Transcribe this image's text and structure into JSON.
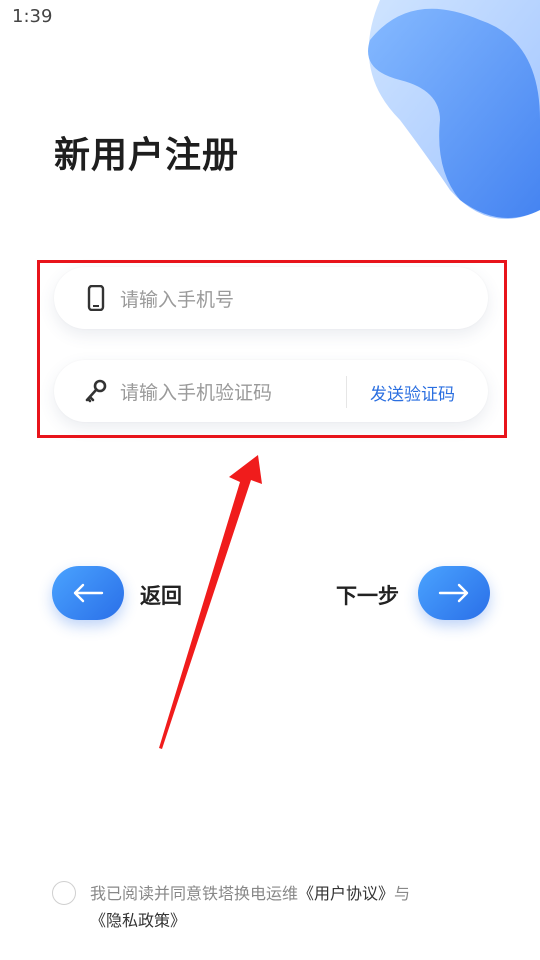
{
  "status_bar": {
    "time": "1:39",
    "icons": [
      "wifi-icon",
      "signal-icon",
      "battery-charging-icon"
    ]
  },
  "page": {
    "title": "新用户注册"
  },
  "form": {
    "phone": {
      "placeholder": "请输入手机号",
      "icon": "phone-icon"
    },
    "code": {
      "placeholder": "请输入手机验证码",
      "icon": "key-icon",
      "send_label": "发送验证码"
    }
  },
  "nav": {
    "back_label": "返回",
    "next_label": "下一步"
  },
  "agreement": {
    "prefix": "我已阅读并同意铁塔换电运维",
    "user_agreement": "《用户协议》",
    "conjunction": "与",
    "privacy_policy": "《隐私政策》"
  },
  "colors": {
    "accent": "#2b6fe0",
    "highlight_box": "#e8141b",
    "annotation_arrow": "#f01c1c"
  }
}
